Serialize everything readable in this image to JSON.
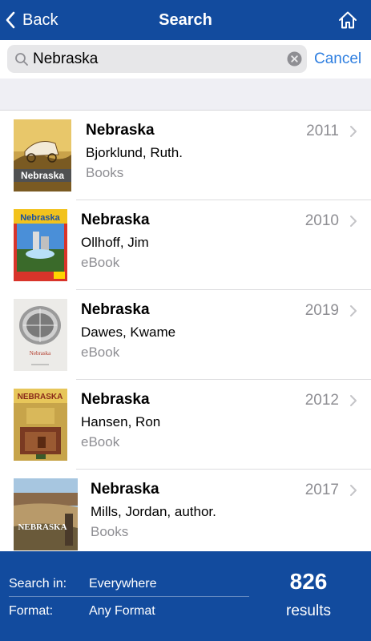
{
  "nav": {
    "back_label": "Back",
    "title": "Search"
  },
  "search": {
    "query": "Nebraska",
    "cancel_label": "Cancel"
  },
  "results": [
    {
      "title": "Nebraska",
      "author": "Bjorklund, Ruth.",
      "format": "Books",
      "year": "2011",
      "cover_title": "Nebraska"
    },
    {
      "title": "Nebraska",
      "author": "Ollhoff, Jim",
      "format": "eBook",
      "year": "2010",
      "cover_title": "Nebraska"
    },
    {
      "title": "Nebraska",
      "author": "Dawes, Kwame",
      "format": "eBook",
      "year": "2019",
      "cover_title": "Nebraska"
    },
    {
      "title": "Nebraska",
      "author": "Hansen, Ron",
      "format": "eBook",
      "year": "2012",
      "cover_title": "NEBRASKA"
    },
    {
      "title": "Nebraska",
      "author": "Mills, Jordan, author.",
      "format": "Books",
      "year": "2017",
      "cover_title": "NEBRASKA"
    }
  ],
  "footer": {
    "search_in_label": "Search in:",
    "search_in_value": "Everywhere",
    "format_label": "Format:",
    "format_value": "Any Format",
    "result_count": "826",
    "result_count_label": "results"
  },
  "colors": {
    "nav_background": "#124b9e",
    "accent": "#2f7fe0",
    "secondary_text": "#8e8e93"
  }
}
